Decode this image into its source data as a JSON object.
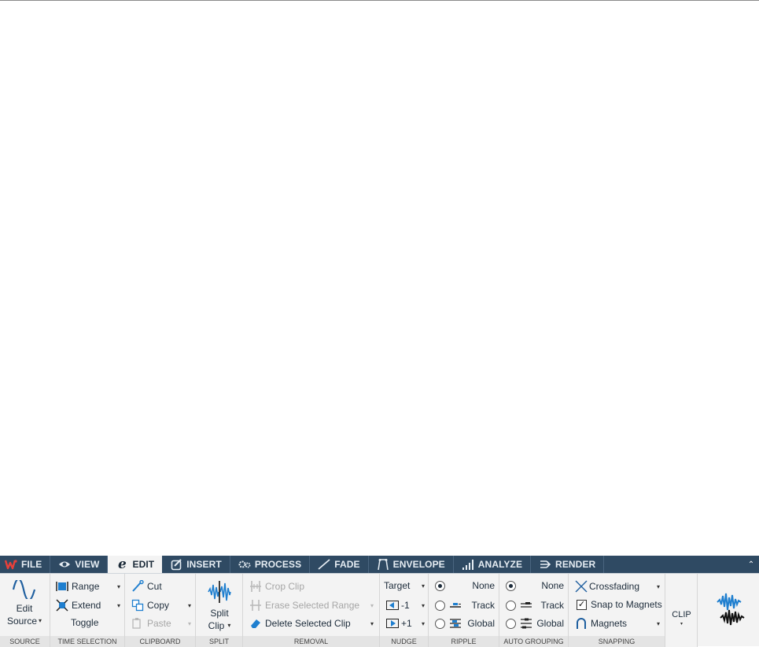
{
  "tabs": [
    {
      "label": "FILE",
      "icon": "wavelab-logo-icon",
      "active": false
    },
    {
      "label": "VIEW",
      "icon": "eye-icon",
      "active": false
    },
    {
      "label": "EDIT",
      "icon": "edit-e-icon",
      "active": true
    },
    {
      "label": "INSERT",
      "icon": "insert-icon",
      "active": false
    },
    {
      "label": "PROCESS",
      "icon": "gears-icon",
      "active": false
    },
    {
      "label": "FADE",
      "icon": "fade-line-icon",
      "active": false
    },
    {
      "label": "ENVELOPE",
      "icon": "envelope-icon",
      "active": false
    },
    {
      "label": "ANALYZE",
      "icon": "bars-icon",
      "active": false
    },
    {
      "label": "RENDER",
      "icon": "render-icon",
      "active": false
    }
  ],
  "collapse_glyph": "⌃",
  "edit_glyph": "e",
  "arrow_glyph": "▾",
  "check_glyph": "✓",
  "ribbon": {
    "source": {
      "label": "SOURCE",
      "edit_line1": "Edit",
      "edit_line2": "Source"
    },
    "time_selection": {
      "label": "TIME SELECTION",
      "range": "Range",
      "extend": "Extend",
      "toggle": "Toggle"
    },
    "clipboard": {
      "label": "CLIPBOARD",
      "cut": "Cut",
      "copy": "Copy",
      "paste": "Paste"
    },
    "split": {
      "label": "SPLIT",
      "line1": "Split",
      "line2": "Clip"
    },
    "removal": {
      "label": "REMOVAL",
      "crop": "Crop Clip",
      "erase": "Erase Selected Range",
      "delete": "Delete Selected Clip"
    },
    "nudge": {
      "label": "NUDGE",
      "target": "Target",
      "minus": "-1",
      "plus": "+1"
    },
    "ripple": {
      "label": "RIPPLE",
      "none": "None",
      "track": "Track",
      "global": "Global",
      "selected": "None"
    },
    "auto_grouping": {
      "label": "AUTO GROUPING",
      "none": "None",
      "track": "Track",
      "global": "Global",
      "selected": "None"
    },
    "snapping": {
      "label": "SNAPPING",
      "crossfading": "Crossfading",
      "snap_to_magnets": "Snap to Magnets",
      "snap_checked": true,
      "magnets": "Magnets"
    },
    "clip": {
      "label": "CLIP"
    }
  },
  "colors": {
    "tabbar": "#2f4a63",
    "accent_blue": "#1f7fcf",
    "ribbon_bg": "#f3f3f3"
  }
}
